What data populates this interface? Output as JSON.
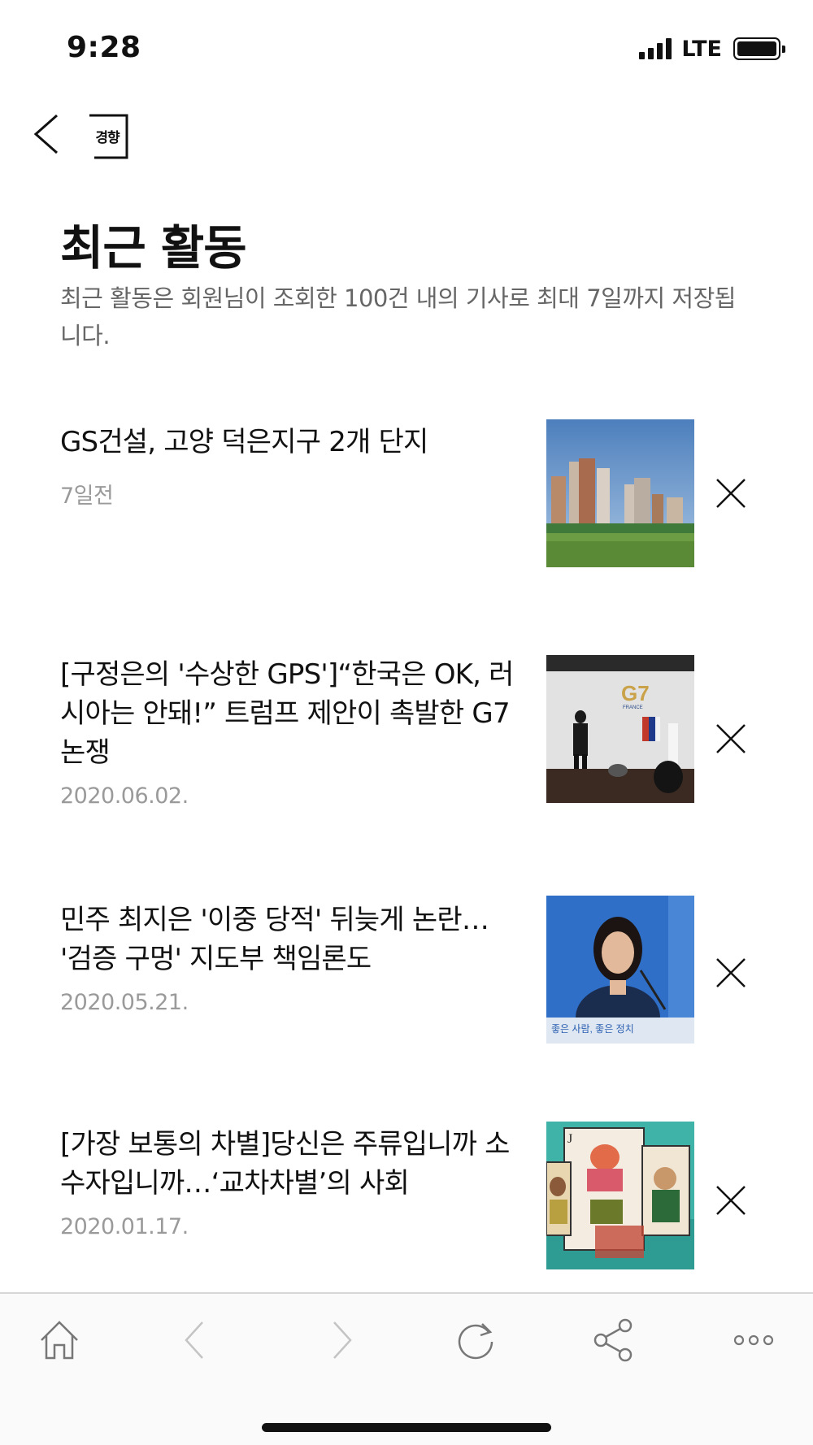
{
  "status_bar": {
    "time": "9:28",
    "network": "LTE",
    "signal_bars": 4,
    "battery_level": 1.0
  },
  "header": {
    "back_icon": "chevron-left-icon",
    "logo_text": "경향"
  },
  "page": {
    "title": "최근 활동",
    "description": "최근 활동은 회원님이 조회한 100건 내의 기사로 최대 7일까지 저장됩니다."
  },
  "articles": [
    {
      "headline": "GS건설, 고양 덕은지구 2개 단지",
      "date": "7일전",
      "thumb_icon": "apartment-photo"
    },
    {
      "headline": "[구정은의 '수상한 GPS']“한국은 OK, 러시아는 안돼!” 트럼프 제안이 촉발한 G7 논쟁",
      "date": "2020.06.02.",
      "thumb_icon": "g7-stage-photo",
      "thumb_logo": "G7",
      "thumb_logo_sub": "FRANCE"
    },
    {
      "headline": "민주 최지은 '이중 당적' 뒤늦게 논란… '검증 구멍' 지도부 책임론도",
      "date": "2020.05.21.",
      "thumb_icon": "press-conference-photo",
      "thumb_banner": "좋은 사람, 좋은 정치"
    },
    {
      "headline": "[가장 보통의 차별]당신은 주류입니까 소수자입니까…‘교차차별’의 사회",
      "date": "2020.01.17.",
      "thumb_icon": "playing-card-illustration",
      "thumb_card_rank": "J"
    }
  ],
  "bottom_nav": {
    "items": [
      "home-icon",
      "back-arrow-icon",
      "forward-arrow-icon",
      "refresh-icon",
      "share-icon",
      "more-icon"
    ]
  },
  "colors": {
    "text": "#111111",
    "secondary_text": "#666666",
    "date_text": "#9a9a9a",
    "nav_disabled": "#c4c4c4",
    "nav_enabled": "#777777"
  }
}
